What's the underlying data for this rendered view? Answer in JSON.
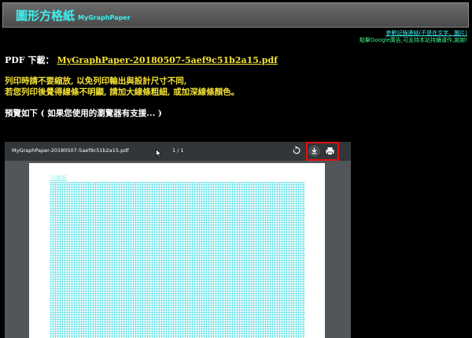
{
  "header": {
    "title": "圖形方格紙",
    "subtitle": "MyGraphPaper"
  },
  "refs": {
    "link": "參數記錄連結(不是在文字、圖片)",
    "ad": "點擊Google廣告,可支持本站持續運作,謝謝!"
  },
  "pdf": {
    "label": "PDF 下載：",
    "filename": "MyGraphPaper-20180507-5aef9c51b2a15.pdf"
  },
  "warning": {
    "line1": "列印時請不要縮放, 以免列印輸出與設計尺寸不同,",
    "line2": "若您列印後覺得線條不明顯, 請加大線條粗細, 或加深線條顏色。"
  },
  "preview_text": "預覽如下 ( 如果您使用的瀏覽器有支援... )",
  "viewer": {
    "filename": "MyGraphPaper-20180507-5aef9c51b2a15.pdf",
    "page_indicator": "1 / 1",
    "paper_label": "沾圖紙",
    "grid_color": "#7fe6ec",
    "highlight_color": "#e01010"
  }
}
